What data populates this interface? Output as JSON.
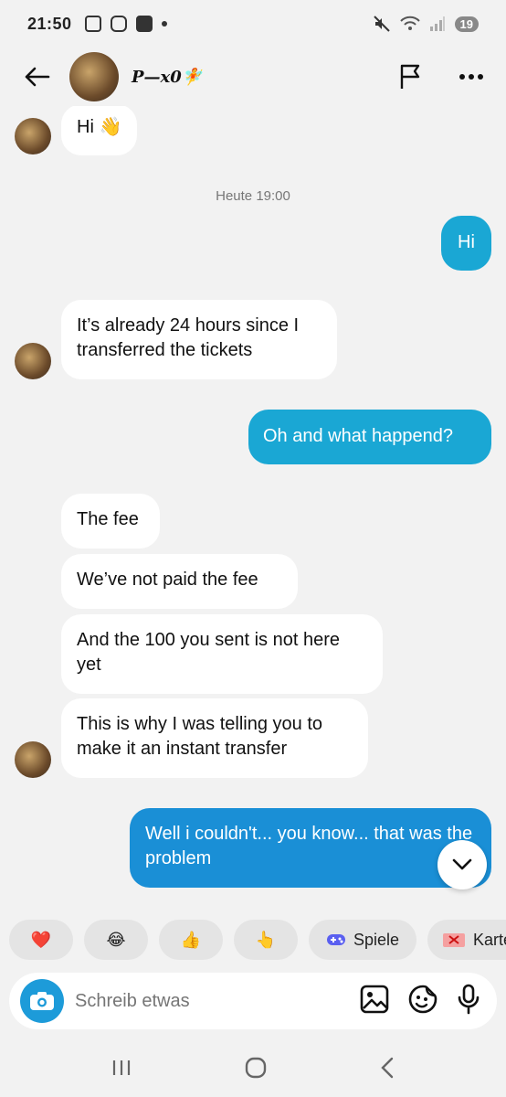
{
  "status_bar": {
    "time": "21:50",
    "battery": "19"
  },
  "header": {
    "contact_name": "P—x0🧚"
  },
  "messages": [
    {
      "text": "Hi 👋"
    },
    {
      "text": "Heute 19:00"
    },
    {
      "text": "Hi"
    },
    {
      "text": "It’s already 24 hours since I transferred the tickets"
    },
    {
      "text": "Oh and what happend?"
    },
    {
      "text": "The fee"
    },
    {
      "text": "We’ve not paid the fee"
    },
    {
      "text": "And the 100 you sent is not here yet"
    },
    {
      "text": "This is  why I was telling you to make it an instant transfer"
    },
    {
      "text": "Well i couldn't... you know... that was the problem"
    }
  ],
  "quick_replies": [
    {
      "label": "❤️",
      "icon": "heart-icon"
    },
    {
      "label": "😂",
      "icon": "laughing-emoji-icon"
    },
    {
      "label": "👍",
      "icon": "thumbs-up-icon"
    },
    {
      "label": "👆",
      "icon": "pointing-up-icon"
    },
    {
      "label": "Spiele",
      "icon": "gamepad-icon"
    },
    {
      "label": "Karte",
      "icon": "gift-card-icon"
    }
  ],
  "composer": {
    "placeholder": "Schreib etwas"
  },
  "colors": {
    "outgoing_bubble": "#1aa7d4",
    "outgoing_bubble_alt": "#1a8fd6",
    "camera_button": "#1d9bd9",
    "incoming_bubble": "#ffffff",
    "background": "#f2f2f2"
  }
}
